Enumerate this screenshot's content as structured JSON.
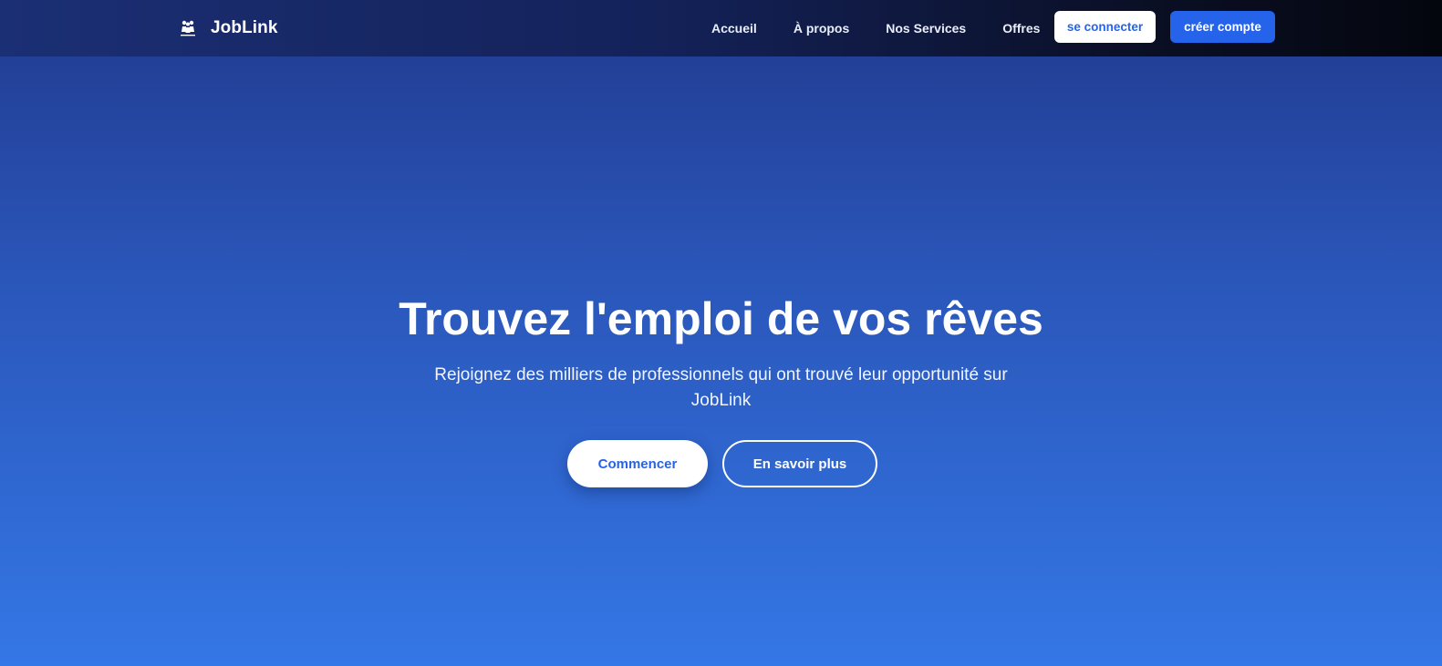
{
  "navbar": {
    "brand": {
      "name": "JobLink",
      "logo_icon": "people-group-logo-icon"
    },
    "links": [
      {
        "label": "Accueil"
      },
      {
        "label": "À propos"
      },
      {
        "label": "Nos Services"
      },
      {
        "label": "Offres"
      }
    ],
    "login_label": "se connecter",
    "signup_label": "créer compte"
  },
  "hero": {
    "title": "Trouvez l'emploi de vos rêves",
    "subtitle": "Rejoignez des milliers de professionnels qui ont trouvé leur opportunité sur JobLink",
    "primary_button": "Commencer",
    "secondary_button": "En savoir plus"
  },
  "colors": {
    "accent": "#2563eb",
    "navbar_dark": "#04060e",
    "hero_top": "#213a8e",
    "hero_bottom": "#3477e6",
    "white": "#ffffff"
  }
}
